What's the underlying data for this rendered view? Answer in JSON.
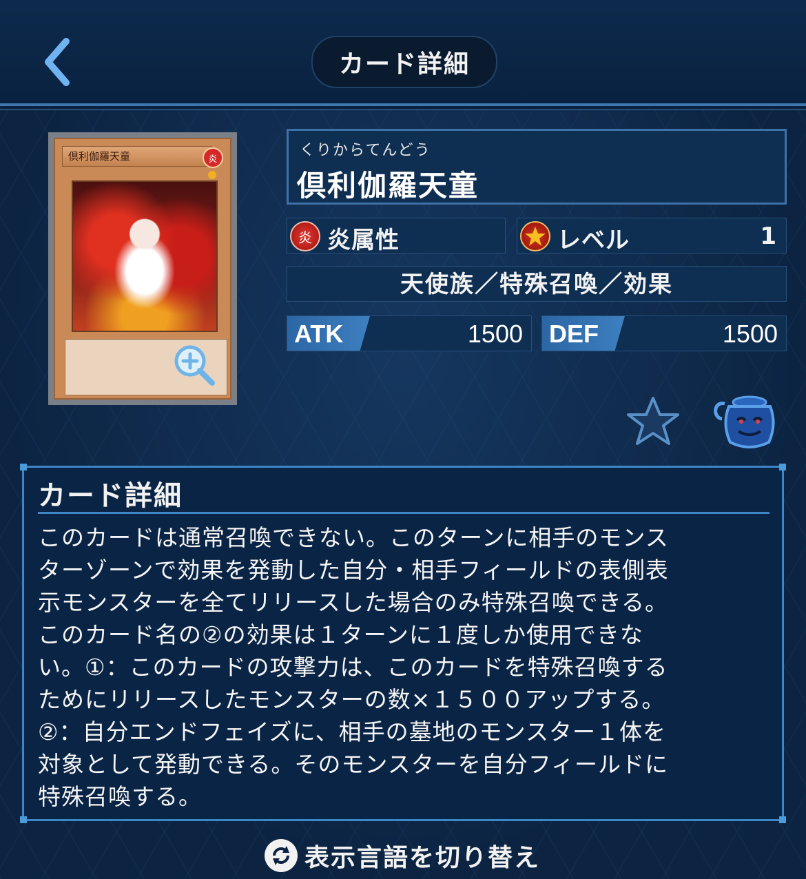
{
  "header": {
    "title": "カード詳細"
  },
  "card": {
    "image_name_text": "倶利伽羅天童",
    "image_attribute_glyph": "炎",
    "ruby": "くりからてんどう",
    "name": "倶利伽羅天童",
    "attribute_label": "炎属性",
    "attribute_icon_glyph": "炎",
    "level_label": "レベル",
    "level_value": "1",
    "types": "天使族／特殊召喚／効果",
    "atk_label": "ATK",
    "atk_value": "1500",
    "def_label": "DEF",
    "def_value": "1500"
  },
  "detail": {
    "title": "カード詳細",
    "lines": [
      "このカードは通常召喚できない。このターンに相手のモンス",
      "ターゾーンで効果を発動した自分・相手フィールドの表側表",
      "示モンスターを全てリリースした場合のみ特殊召喚できる。",
      "このカード名の②の効果は１ターンに１度しか使用できな",
      "い。①：このカードの攻撃力は、このカードを特殊召喚する",
      "ためにリリースしたモンスターの数×１５００アップする。",
      "②：自分エンドフェイズに、相手の墓地のモンスター１体を",
      "対象として発動できる。そのモンスターを自分フィールドに",
      "特殊召喚する。"
    ]
  },
  "footer": {
    "lang_switch_label": "表示言語を切り替え"
  },
  "icons": {
    "back": "chevron-left-icon",
    "zoom": "zoom-in-icon",
    "favorite": "star-icon",
    "pot": "pot-icon",
    "attribute": "fire-attribute-icon",
    "level": "level-star-icon",
    "lang": "refresh-icon"
  },
  "colors": {
    "background": "#0c2442",
    "accent": "#3d86c8",
    "panel": "#0e2e52"
  }
}
